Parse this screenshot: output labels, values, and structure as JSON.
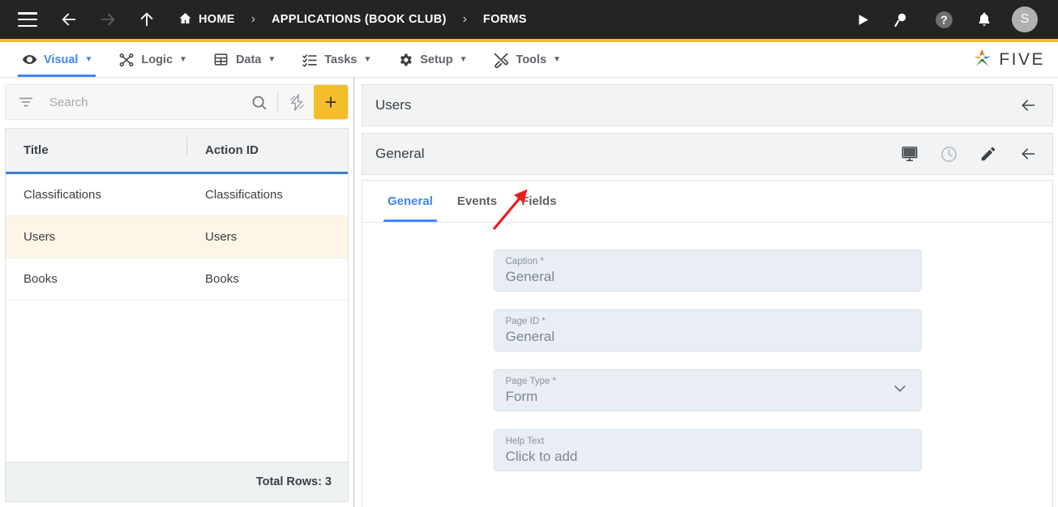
{
  "topbar": {
    "menu_icon": "hamburger-menu-icon",
    "back_icon": "back-arrow-icon",
    "forward_icon": "forward-arrow-icon",
    "up_icon": "up-arrow-icon",
    "breadcrumbs": [
      {
        "label": "HOME",
        "icon": "home-icon"
      },
      {
        "label": "APPLICATIONS (BOOK CLUB)",
        "icon": ""
      },
      {
        "label": "FORMS",
        "icon": ""
      }
    ],
    "separator": "›",
    "actions": [
      {
        "name": "run-button",
        "icon": "play-icon"
      },
      {
        "name": "search-run-button",
        "icon": "search-play-icon"
      },
      {
        "name": "help-button",
        "icon": "help-circle-icon"
      },
      {
        "name": "notifications-button",
        "icon": "bell-icon"
      }
    ],
    "avatar_initial": "S",
    "accent_color": "#f5bc2b",
    "background_color": "#242424"
  },
  "menubar": {
    "items": [
      {
        "label": "Visual",
        "icon": "eye-icon",
        "caret": "▼",
        "active": true
      },
      {
        "label": "Logic",
        "icon": "logic-nodes-icon",
        "caret": "▼",
        "active": false
      },
      {
        "label": "Data",
        "icon": "table-grid-icon",
        "caret": "▼",
        "active": false
      },
      {
        "label": "Tasks",
        "icon": "checklist-icon",
        "caret": "▼",
        "active": false
      },
      {
        "label": "Setup",
        "icon": "gear-icon",
        "caret": "▼",
        "active": false
      },
      {
        "label": "Tools",
        "icon": "tools-icon",
        "caret": "▼",
        "active": false
      }
    ],
    "brand": "FIVE",
    "active_color": "#4285f4"
  },
  "sidebar": {
    "search": {
      "placeholder": "Search",
      "value": ""
    },
    "filter_icon": "filter-icon",
    "search_icon": "search-icon",
    "lightning_icon": "lightning-bolt-icon",
    "add_button_label": "+",
    "grid": {
      "columns": [
        "Title",
        "Action ID"
      ],
      "rows": [
        {
          "title": "Classifications",
          "action_id": "Classifications",
          "selected": false
        },
        {
          "title": "Users",
          "action_id": "Users",
          "selected": true
        },
        {
          "title": "Books",
          "action_id": "Books",
          "selected": false
        }
      ]
    },
    "footer": "Total Rows: 3",
    "selected_row_color": "#fdf5e6"
  },
  "main": {
    "record_header": {
      "title": "Users",
      "back_icon": "back-arrow-icon"
    },
    "section_header": {
      "title": "General",
      "icons": [
        {
          "name": "display-preview-icon"
        },
        {
          "name": "clock-icon"
        },
        {
          "name": "pencil-edit-icon"
        },
        {
          "name": "back-arrow-icon"
        }
      ]
    },
    "tabs": [
      {
        "label": "General",
        "active": true
      },
      {
        "label": "Events",
        "active": false
      },
      {
        "label": "Fields",
        "active": false
      }
    ],
    "fields": [
      {
        "label": "Caption *",
        "value": "General",
        "type": "text"
      },
      {
        "label": "Page ID *",
        "value": "General",
        "type": "text"
      },
      {
        "label": "Page Type *",
        "value": "Form",
        "type": "select"
      },
      {
        "label": "Help Text",
        "value": "Click to add",
        "type": "text"
      }
    ]
  },
  "annotation": {
    "arrow_color": "#e81c1c",
    "points_to": "Fields"
  }
}
